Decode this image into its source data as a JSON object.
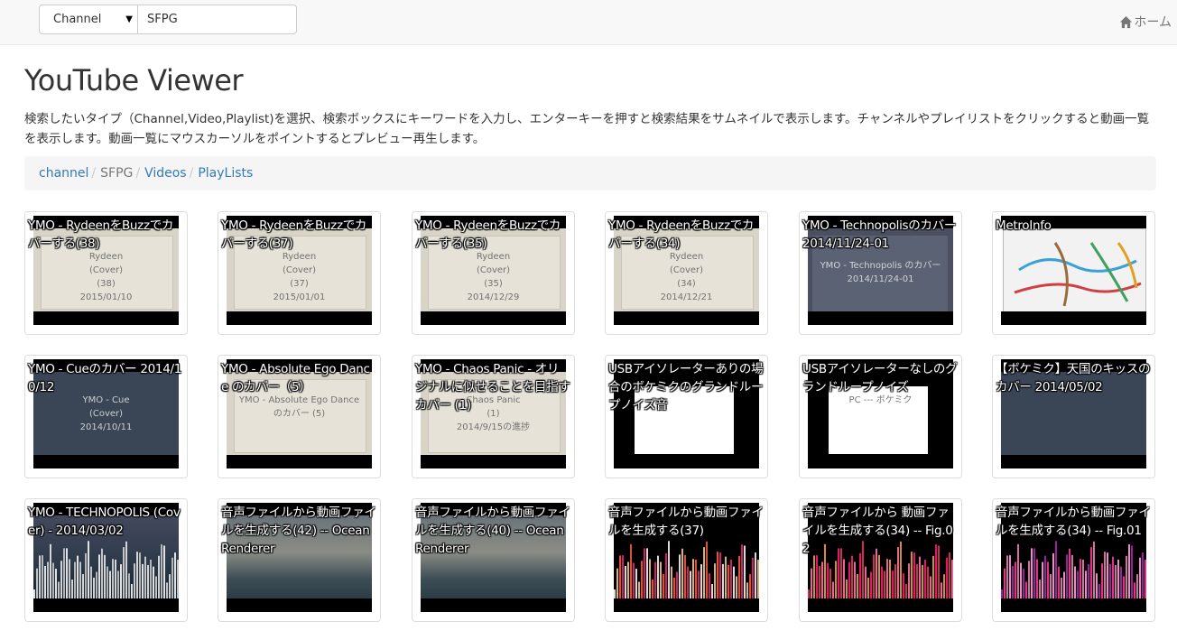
{
  "search": {
    "type_selected": "Channel",
    "query": "SFPG"
  },
  "nav": {
    "home_label": "ホーム"
  },
  "page": {
    "title": "YouTube Viewer",
    "description": "検索したいタイプ（Channel,Video,Playlist)を選択、検索ボックスにキーワードを入力し、エンターキーを押すと検索結果をサムネイルで表示します。チャンネルやプレイリストをクリックすると動画一覧を表示します。動画一覧にマウスカーソルをポイントするとプレビュー再生します。"
  },
  "breadcrumb": [
    {
      "label": "channel",
      "active": false
    },
    {
      "label": "SFPG",
      "active": true
    },
    {
      "label": "Videos",
      "active": false
    },
    {
      "label": "PlayLists",
      "active": false
    }
  ],
  "videos": [
    {
      "title": "YMO - RydeenをBuzzでカバーする(38)",
      "thumb": "ymo",
      "thumb_text": "Rydeen\n(Cover)\n(38)\n2015/01/10"
    },
    {
      "title": "YMO - RydeenをBuzzでカバーする(37)",
      "thumb": "ymo",
      "thumb_text": "Rydeen\n(Cover)\n(37)\n2015/01/01"
    },
    {
      "title": "YMO - RydeenをBuzzでカバーする(35)",
      "thumb": "ymo",
      "thumb_text": "Rydeen\n(Cover)\n(35)\n2014/12/29"
    },
    {
      "title": "YMO - RydeenをBuzzでカバーする(34)",
      "thumb": "ymo",
      "thumb_text": "Rydeen\n(Cover)\n(34)\n2014/12/21"
    },
    {
      "title": "YMO - Technopolisのカバー 2014/11/24-01",
      "thumb": "techno",
      "thumb_text": "YMO - Technopolis のカバー\n2014/11/24-01"
    },
    {
      "title": "MetroInfo",
      "thumb": "metro",
      "thumb_text": ""
    },
    {
      "title": "YMO - Cueのカバー 2014/10/12",
      "thumb": "dark",
      "thumb_text": "YMO - Cue\n(Cover)\n2014/10/11"
    },
    {
      "title": "YMO - Absolute Ego Dance のカバー（5）",
      "thumb": "ymo",
      "thumb_text": "YMO - Absolute Ego Dance\nのカバー (5)"
    },
    {
      "title": "YMO - Chaos Panic - オリジナルに似せることを目指すカバー (1)",
      "thumb": "ymo",
      "thumb_text": "Chaos Panic\n(1)\n2014/9/15の進捗"
    },
    {
      "title": "USBアイソレーターありの場合のボケミクのグランドループノイズ音",
      "thumb": "black",
      "thumb_text": ""
    },
    {
      "title": "USBアイソレーターなしのグランドループノイズ",
      "thumb": "black",
      "thumb_text": "PC --- ボケミク"
    },
    {
      "title": "【ボケミク】天国のキッスのカバー 2014/05/02",
      "thumb": "dark",
      "thumb_text": ""
    },
    {
      "title": "YMO - TECHNOPOLIS (Cover) - 2014/03/02",
      "thumb": "techno2",
      "thumb_text": ""
    },
    {
      "title": "音声ファイルから動画ファイルを生成する(42) -- Ocean Renderer",
      "thumb": "ocean",
      "thumb_text": ""
    },
    {
      "title": "音声ファイルから動画ファイルを生成する(40) -- Ocean Renderer",
      "thumb": "ocean",
      "thumb_text": ""
    },
    {
      "title": "音声ファイルから動画ファイルを生成する(37)",
      "thumb": "spectrum",
      "thumb_text": ""
    },
    {
      "title": "音声ファイルから 動画ファイルを生成する(34) -- Fig.02",
      "thumb": "spectrum2",
      "thumb_text": ""
    },
    {
      "title": "音声ファイルから動画ファイルを生成する(34) -- Fig.01",
      "thumb": "spectrum3",
      "thumb_text": ""
    }
  ],
  "colors": {
    "link": "#337ab7",
    "muted": "#777777",
    "navbar_bg": "#f8f8f8"
  },
  "icons": {
    "home": "home-icon"
  }
}
